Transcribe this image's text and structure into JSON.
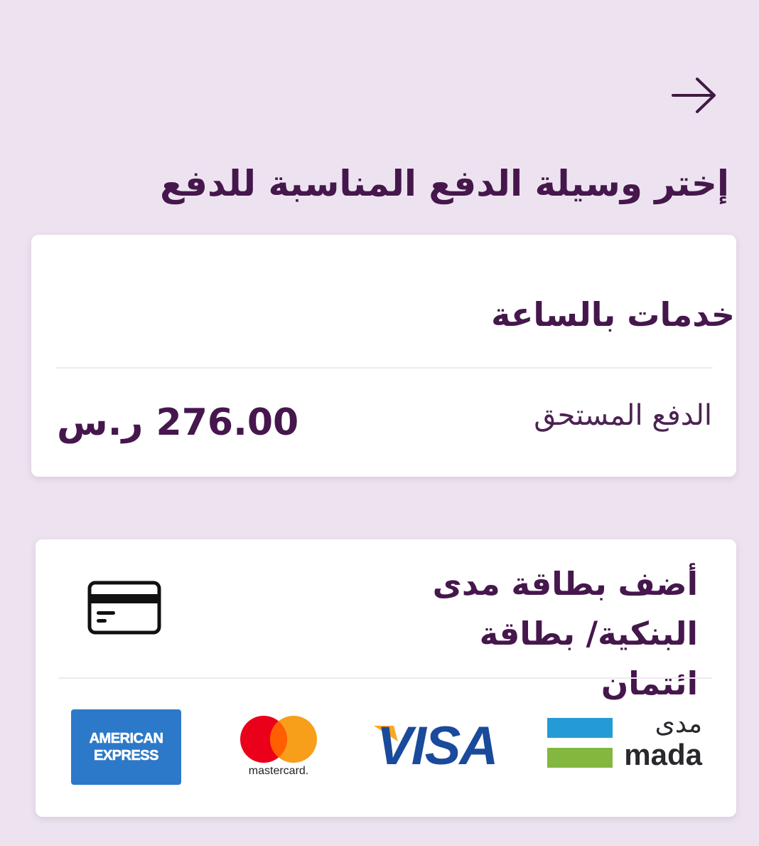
{
  "header": {
    "back_icon": "arrow-right-icon",
    "title": "إختر وسيلة الدفع المناسبة للدفع"
  },
  "summary": {
    "service_name": "خدمات بالساعة",
    "due_label": "الدفع المستحق",
    "due_amount": "276.00 ر.س"
  },
  "add_card": {
    "title": "أضف بطاقة مدى البنكية/ بطاقة ائتمان",
    "icon": "credit-card-icon",
    "logos": {
      "amex_line1": "AMERICAN",
      "amex_line2": "EXPRESS",
      "mastercard": "mastercard.",
      "visa": "VISA",
      "mada_ar": "مدى",
      "mada_en": "mada"
    }
  },
  "colors": {
    "background": "#ede3f0",
    "primary_text": "#45174c",
    "card": "#ffffff"
  }
}
